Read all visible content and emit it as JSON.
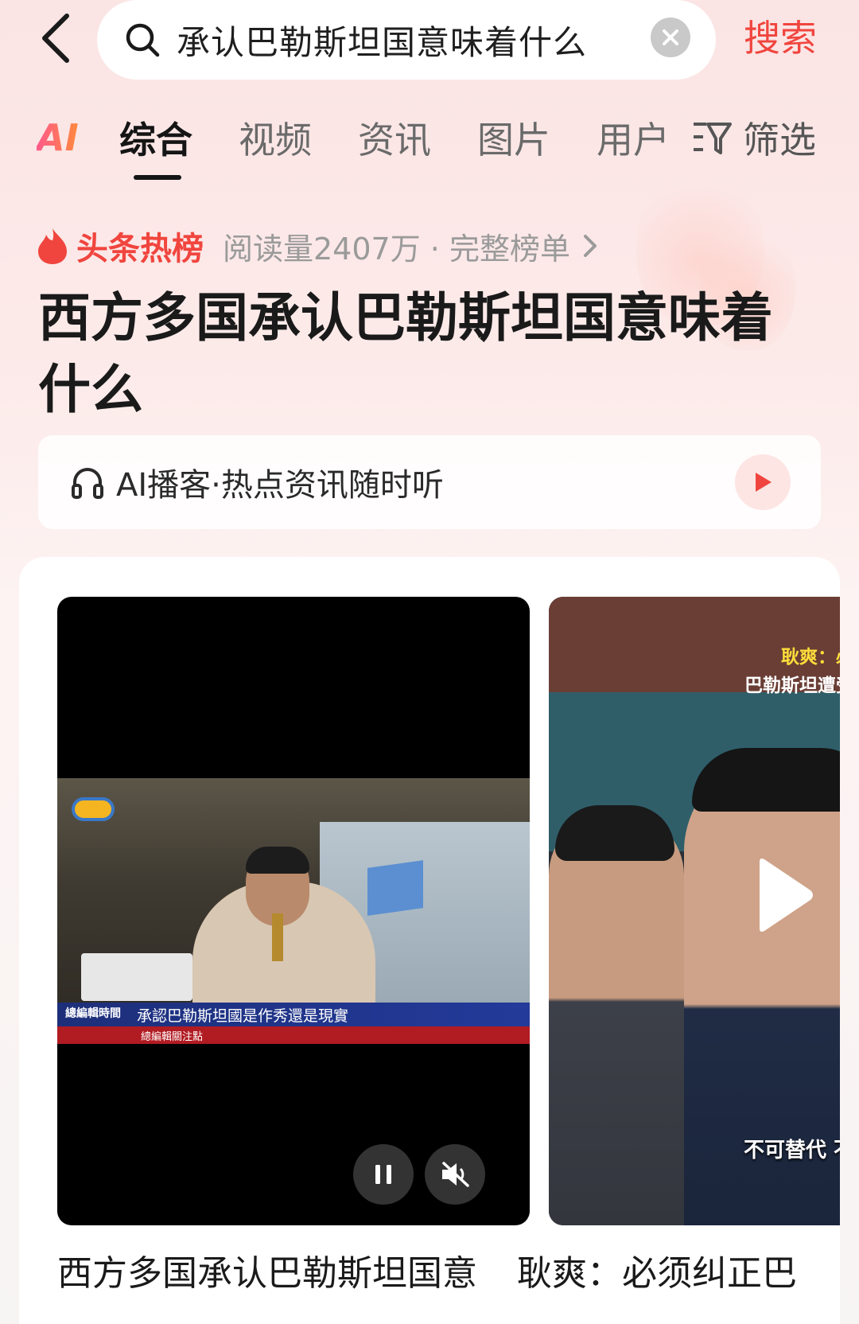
{
  "header": {
    "search_query": "承认巴勒斯坦国意味着什么",
    "search_action": "搜索"
  },
  "tabs": {
    "ai": "AI",
    "items": [
      "综合",
      "视频",
      "资讯",
      "图片",
      "用户"
    ],
    "active": "综合",
    "filter": "筛选"
  },
  "hotlist": {
    "label": "头条热榜",
    "meta": "阅读量2407万 · 完整榜单",
    "title": "西方多国承认巴勒斯坦国意味着什么"
  },
  "podcast": {
    "text": "AI播客·热点资讯随时听"
  },
  "results": [
    {
      "ticker_brand": "總編輯時間",
      "ticker_headline": "承認巴勒斯坦國是作秀還是現實",
      "ticker_sub": "總編輯關注點",
      "caption": "西方多国承认巴勒斯坦国意"
    },
    {
      "overlay_line1": "耿爽：必须纠",
      "overlay_line2": "巴勒斯坦遭受的历",
      "overlay_bottom": "不可替代 不容",
      "caption": "耿爽：必须纠正巴"
    }
  ],
  "colors": {
    "accent": "#f0453e",
    "tab_active": "#151515",
    "tab_inactive": "#6a6a6a"
  }
}
